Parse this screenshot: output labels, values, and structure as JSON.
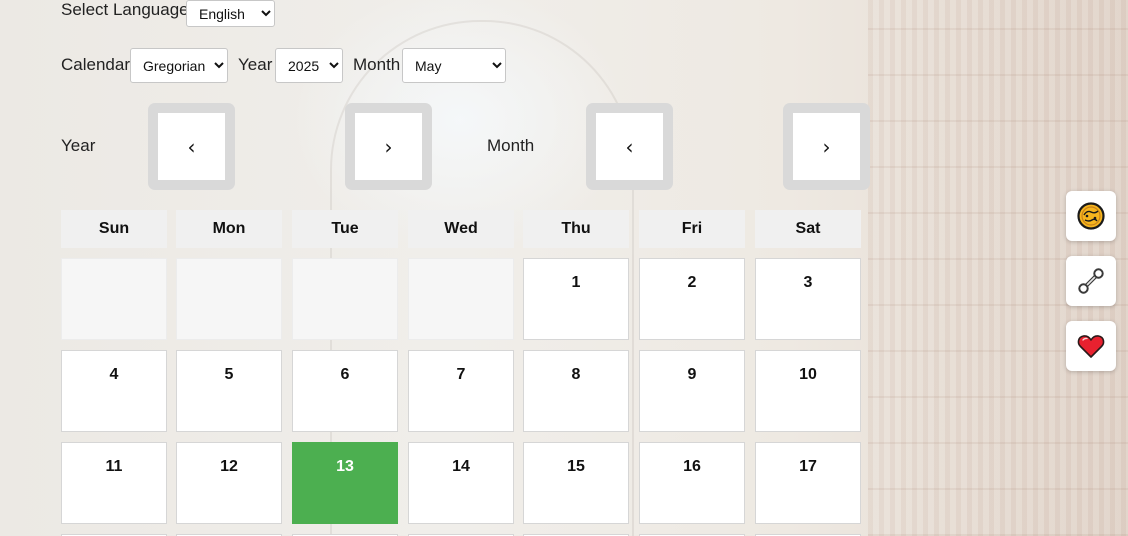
{
  "language": {
    "label": "Select Language",
    "selected": "English"
  },
  "calendar_controls": {
    "calendar_label": "Calendar",
    "calendar_selected": "Gregorian",
    "year_label": "Year",
    "year_selected": "2025",
    "month_label": "Month",
    "month_selected": "May"
  },
  "navigation": {
    "year_label": "Year",
    "month_label": "Month",
    "prev_symbol": "‹",
    "next_symbol": "›"
  },
  "weekdays": [
    "Sun",
    "Mon",
    "Tue",
    "Wed",
    "Thu",
    "Fri",
    "Sat"
  ],
  "days": {
    "leading_blanks": 4,
    "visible": [
      "1",
      "2",
      "3",
      "4",
      "5",
      "6",
      "7",
      "8",
      "9",
      "10",
      "11",
      "12",
      "13",
      "14",
      "15",
      "16",
      "17"
    ],
    "selected": "13"
  },
  "colors": {
    "selected_day": "#4caf50",
    "heart": "#e8212f"
  },
  "side_buttons": [
    {
      "icon": "orange-globe-icon"
    },
    {
      "icon": "wrench-icon"
    },
    {
      "icon": "heart-icon"
    }
  ]
}
